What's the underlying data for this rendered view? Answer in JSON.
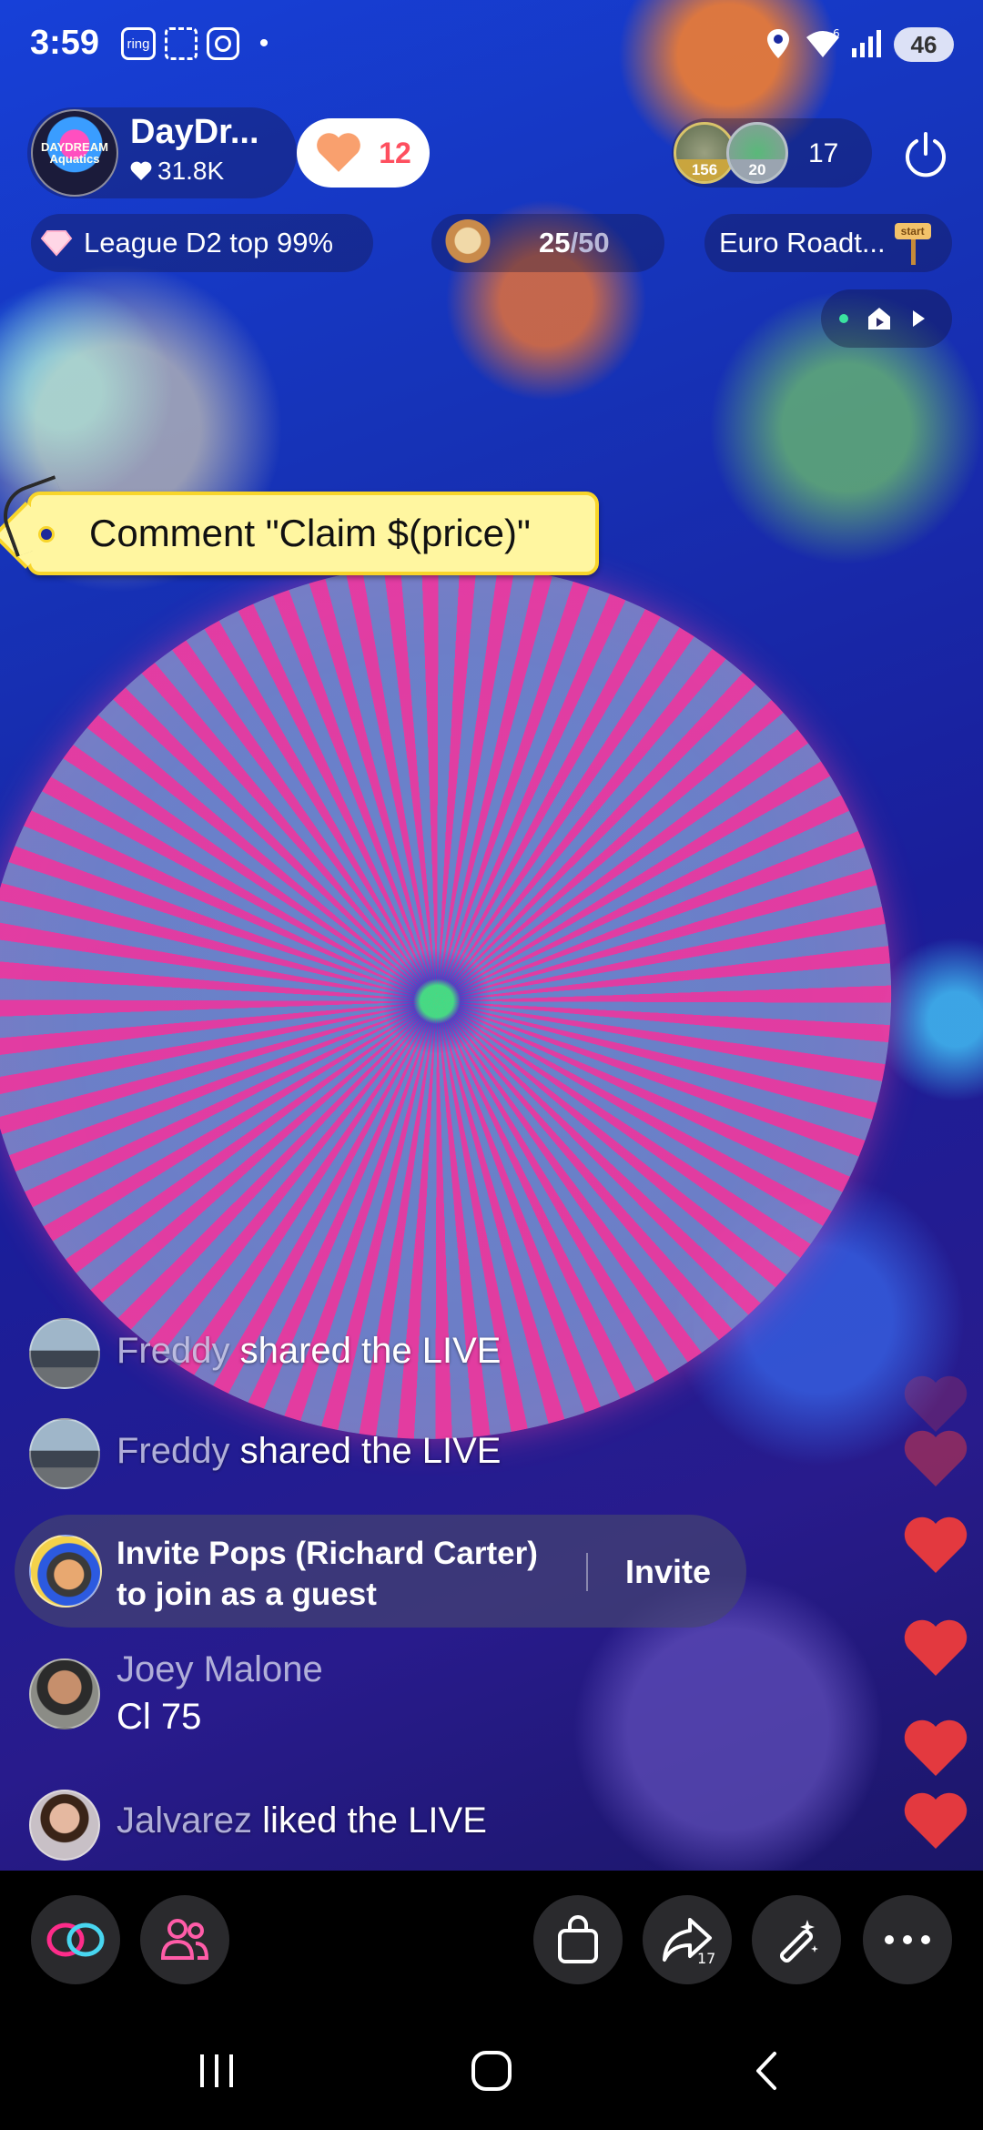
{
  "status_bar": {
    "time": "3:59",
    "ring_label": "ring",
    "wifi_generation": "6",
    "battery": "46",
    "icons": [
      "ring-icon",
      "screen-scan-icon",
      "instagram-icon",
      "notification-dot-icon",
      "location-icon",
      "wifi-icon",
      "signal-icon",
      "battery-icon"
    ]
  },
  "host": {
    "avatar_text": "DAYDREAM Aquatics",
    "name": "DayDr...",
    "likes": "31.8K",
    "follow_count": "12"
  },
  "viewers": {
    "top1_badge": "156",
    "top2_badge": "20",
    "count": "17"
  },
  "league": {
    "label": "League D2 top 99%"
  },
  "goal": {
    "current": "25",
    "total": "/50"
  },
  "event": {
    "label": "Euro Roadt..."
  },
  "claim_tag": {
    "text": "Comment \"Claim $(price)\""
  },
  "chat": [
    {
      "user": "Freddy",
      "action": " shared the LIVE"
    },
    {
      "user": "Freddy",
      "action": " shared the LIVE"
    }
  ],
  "invite": {
    "line1": "Invite Pops (Richard Carter)",
    "line2": "to join as a guest",
    "button": "Invite"
  },
  "comment": {
    "user": "Joey Malone",
    "message": "Cl 75"
  },
  "last_chat": {
    "user": "Jalvarez",
    "action": " liked the LIVE"
  },
  "toolbar": {
    "share_count": "17",
    "icons": [
      "link-guest-icon",
      "multi-guest-icon",
      "shopping-bag-icon",
      "share-icon",
      "magic-wand-icon",
      "more-icon"
    ]
  },
  "colors": {
    "accent_pink": "#fe2c55",
    "heart": "#e3393f",
    "tag_yellow": "#fff6a0"
  }
}
